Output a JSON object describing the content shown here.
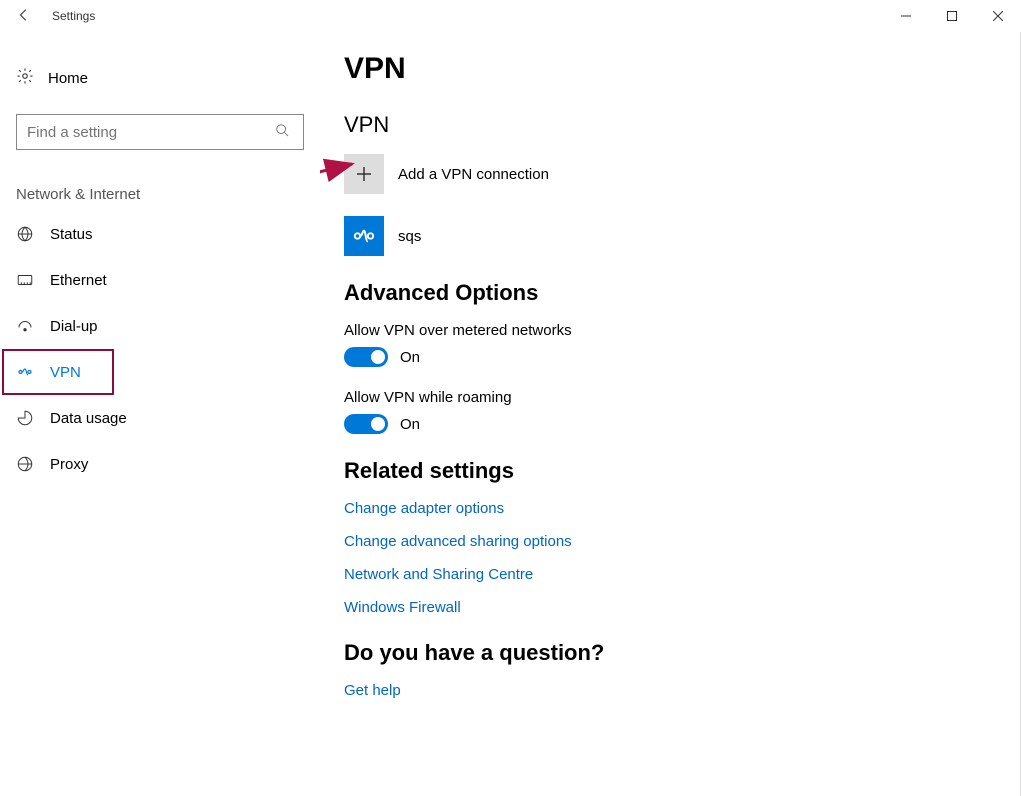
{
  "window": {
    "title": "Settings"
  },
  "sidebar": {
    "home": "Home",
    "search_placeholder": "Find a setting",
    "category": "Network & Internet",
    "items": [
      {
        "label": "Status"
      },
      {
        "label": "Ethernet"
      },
      {
        "label": "Dial-up"
      },
      {
        "label": "VPN"
      },
      {
        "label": "Data usage"
      },
      {
        "label": "Proxy"
      }
    ]
  },
  "main": {
    "title": "VPN",
    "vpn_header": "VPN",
    "add_label": "Add a VPN connection",
    "connections": [
      {
        "name": "sqs"
      }
    ],
    "advanced_header": "Advanced Options",
    "opt_metered": {
      "label": "Allow VPN over metered networks",
      "state": "On"
    },
    "opt_roaming": {
      "label": "Allow VPN while roaming",
      "state": "On"
    },
    "related_header": "Related settings",
    "related_links": [
      "Change adapter options",
      "Change advanced sharing options",
      "Network and Sharing Centre",
      "Windows Firewall"
    ],
    "question_header": "Do you have a question?",
    "help_link": "Get help"
  }
}
